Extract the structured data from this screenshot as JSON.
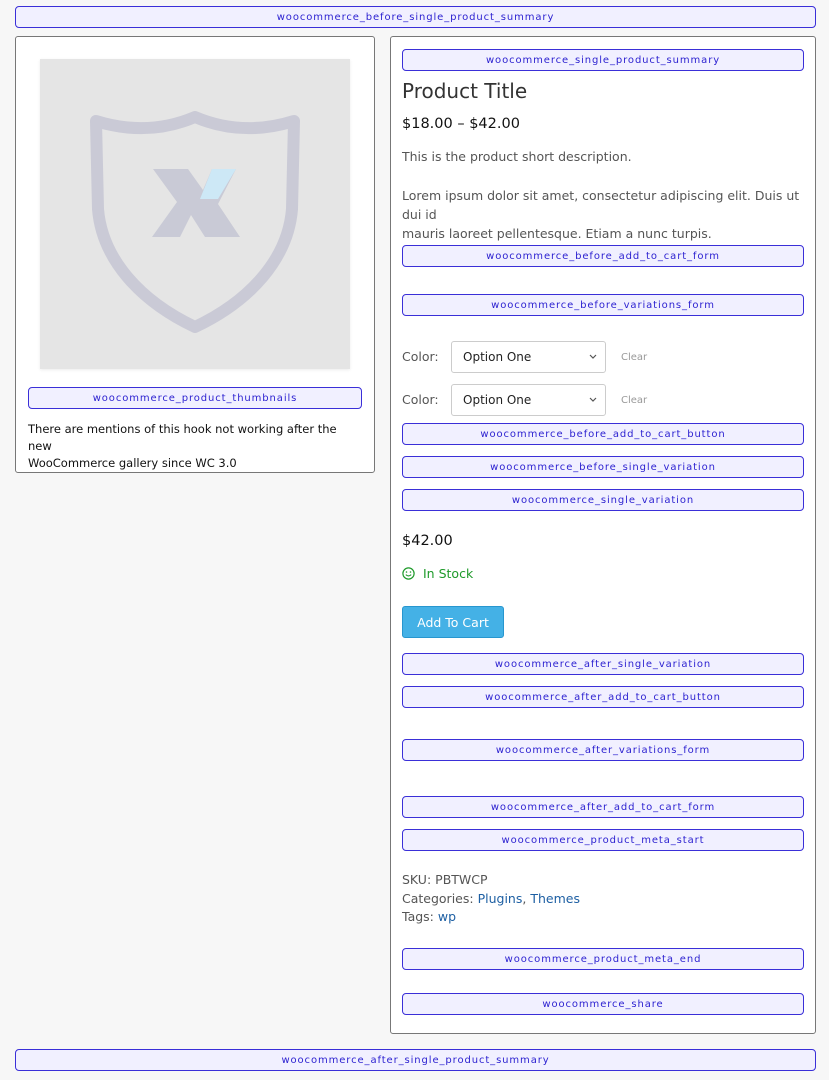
{
  "hooks": {
    "before_summary": "woocommerce_before_single_product_summary",
    "single_summary": "woocommerce_single_product_summary",
    "before_form": "woocommerce_before_add_to_cart_form",
    "before_variations": "woocommerce_before_variations_form",
    "before_button": "woocommerce_before_add_to_cart_button",
    "before_single_variation": "woocommerce_before_single_variation",
    "single_variation": "woocommerce_single_variation",
    "after_single_variation": "woocommerce_after_single_variation",
    "after_button": "woocommerce_after_add_to_cart_button",
    "after_variations": "woocommerce_after_variations_form",
    "after_form": "woocommerce_after_add_to_cart_form",
    "meta_start": "woocommerce_product_meta_start",
    "meta_end": "woocommerce_product_meta_end",
    "share": "woocommerce_share",
    "thumbnails": "woocommerce_product_thumbnails",
    "after_summary": "woocommerce_after_single_product_summary"
  },
  "gallery": {
    "note_line1": "There are mentions of this hook not working after the new",
    "note_line2": "WooCommerce gallery since WC 3.0",
    "placeholder_icon": "shield-x-logo"
  },
  "product": {
    "title": "Product Title",
    "price_range": "$18.00 – $42.00",
    "short_desc": "This is the product short description.",
    "lorem_line1": "Lorem ipsum dolor sit amet, consectetur adipiscing elit. Duis ut dui id",
    "lorem_line2": "mauris laoreet pellentesque. Etiam a nunc turpis."
  },
  "variations": [
    {
      "label": "Color:",
      "selected": "Option One",
      "clear": "Clear"
    },
    {
      "label": "Color:",
      "selected": "Option One",
      "clear": "Clear"
    }
  ],
  "variation": {
    "price": "$42.00",
    "stock": "In Stock",
    "stock_icon": "smiley-icon",
    "add_to_cart": "Add To Cart"
  },
  "meta": {
    "sku_label": "SKU:",
    "sku_value": "PBTWCP",
    "categories_label": "Categories:",
    "categories": [
      "Plugins",
      "Themes"
    ],
    "category_sep": ",",
    "tags_label": "Tags:",
    "tags": [
      "wp"
    ]
  },
  "colors": {
    "hook_border": "#3a2fd8",
    "hook_bg": "#f1f0ff",
    "button": "#44b1e6",
    "in_stock": "#1e9a2a",
    "link": "#1d5fa3"
  }
}
